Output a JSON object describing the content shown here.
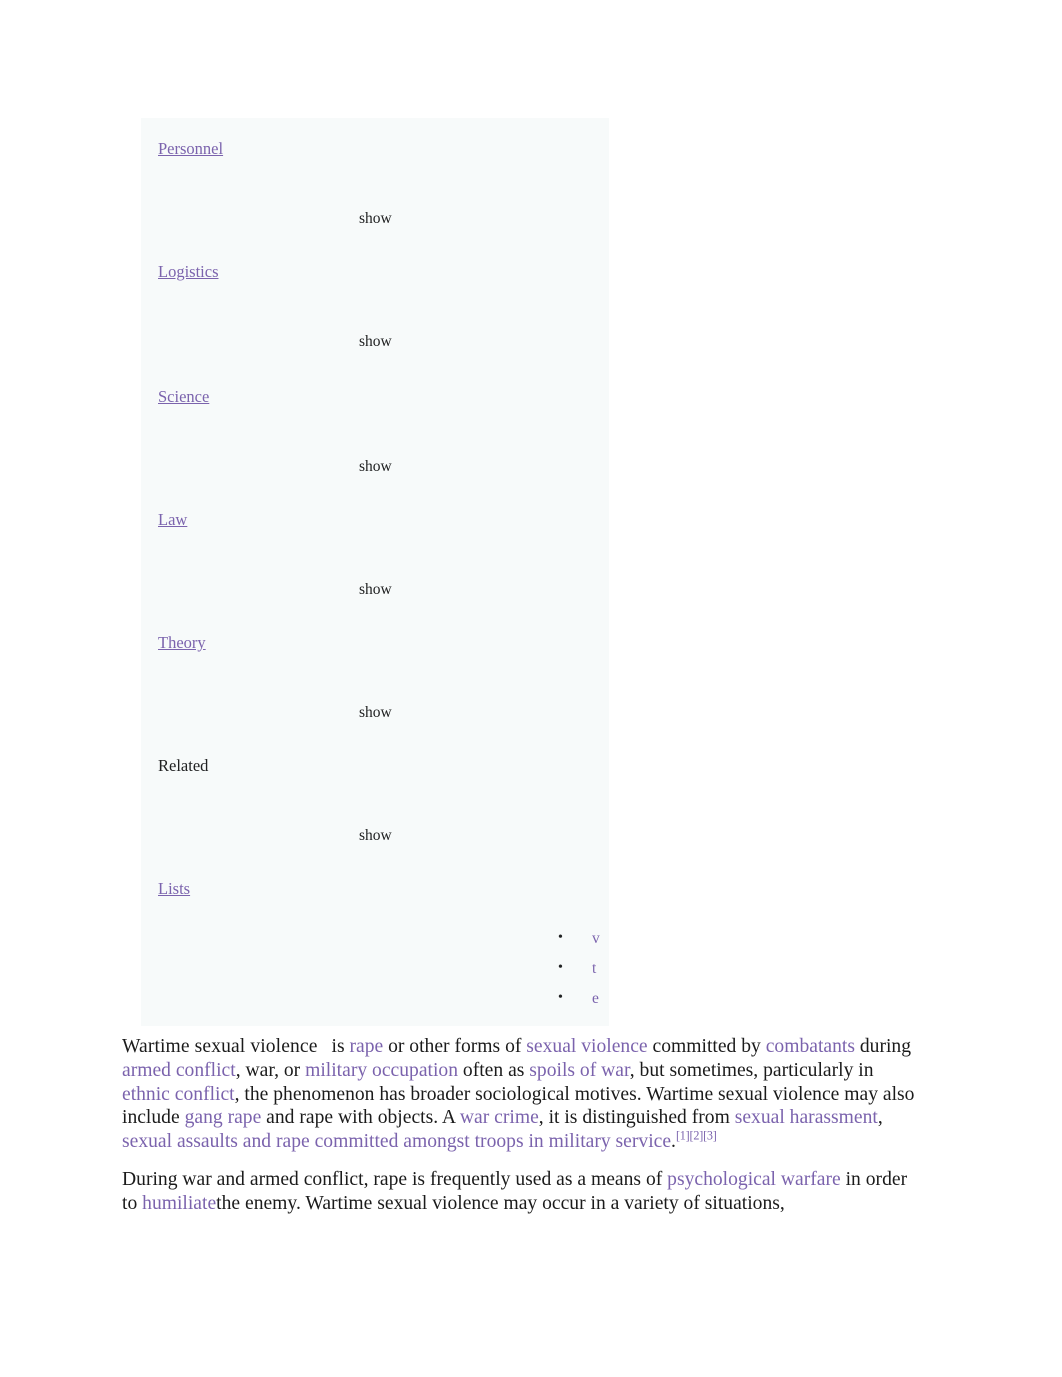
{
  "navbox": {
    "rows": [
      {
        "label": "Personnel",
        "is_link": true,
        "toggle": "show"
      },
      {
        "label": "Logistics",
        "is_link": true,
        "toggle": "show"
      },
      {
        "label": "Science",
        "is_link": true,
        "toggle": "show"
      },
      {
        "label": "Law",
        "is_link": true,
        "toggle": "show"
      },
      {
        "label": "Theory",
        "is_link": true,
        "toggle": "show"
      },
      {
        "label": "Related",
        "is_link": false,
        "toggle": "show"
      },
      {
        "label": "Lists",
        "is_link": true,
        "toggle": ""
      }
    ],
    "vte": [
      {
        "label": "v"
      },
      {
        "label": "t"
      },
      {
        "label": "e"
      }
    ]
  },
  "article": {
    "paragraph1": {
      "term": "Wartime sexual violence",
      "t1": "is ",
      "l1": "rape",
      "t2": " or other forms of ",
      "l2": "sexual violence",
      "t3": " committed by ",
      "l3": "combatants",
      "t4": " during ",
      "l4": "armed conflict",
      "t5": ", war, or ",
      "l5": "military occupation",
      "t6": " often as ",
      "l6": "spoils of war",
      "t7": ", but sometimes, particularly in ",
      "l7": "ethnic conflict",
      "t8": ", the phenomenon has broader sociological motives. Wartime sexual violence may also include ",
      "l8": "gang rape",
      "t9": " and rape with objects. A ",
      "l9": "war crime",
      "t10": ", it is distinguished from ",
      "l10": "sexual harassment",
      "t11": ", ",
      "l11": "sexual assaults and rape committed amongst troops in military service",
      "t12": ".",
      "ref1": "[1]",
      "ref2": "[2]",
      "ref3": "[3]"
    },
    "paragraph2": {
      "t1": "During war and armed conflict, rape is frequently used as a means of ",
      "l1": "psychological warfare",
      "t2": " in order to ",
      "l2": "humiliate",
      "t3": "the enemy. Wartime sexual violence may occur in a variety of situations,"
    }
  },
  "colors": {
    "link": "#7b63ad",
    "text": "#1b1b1b",
    "navbox_bg": "#f7fafa",
    "page_bg": "#ffffff"
  }
}
